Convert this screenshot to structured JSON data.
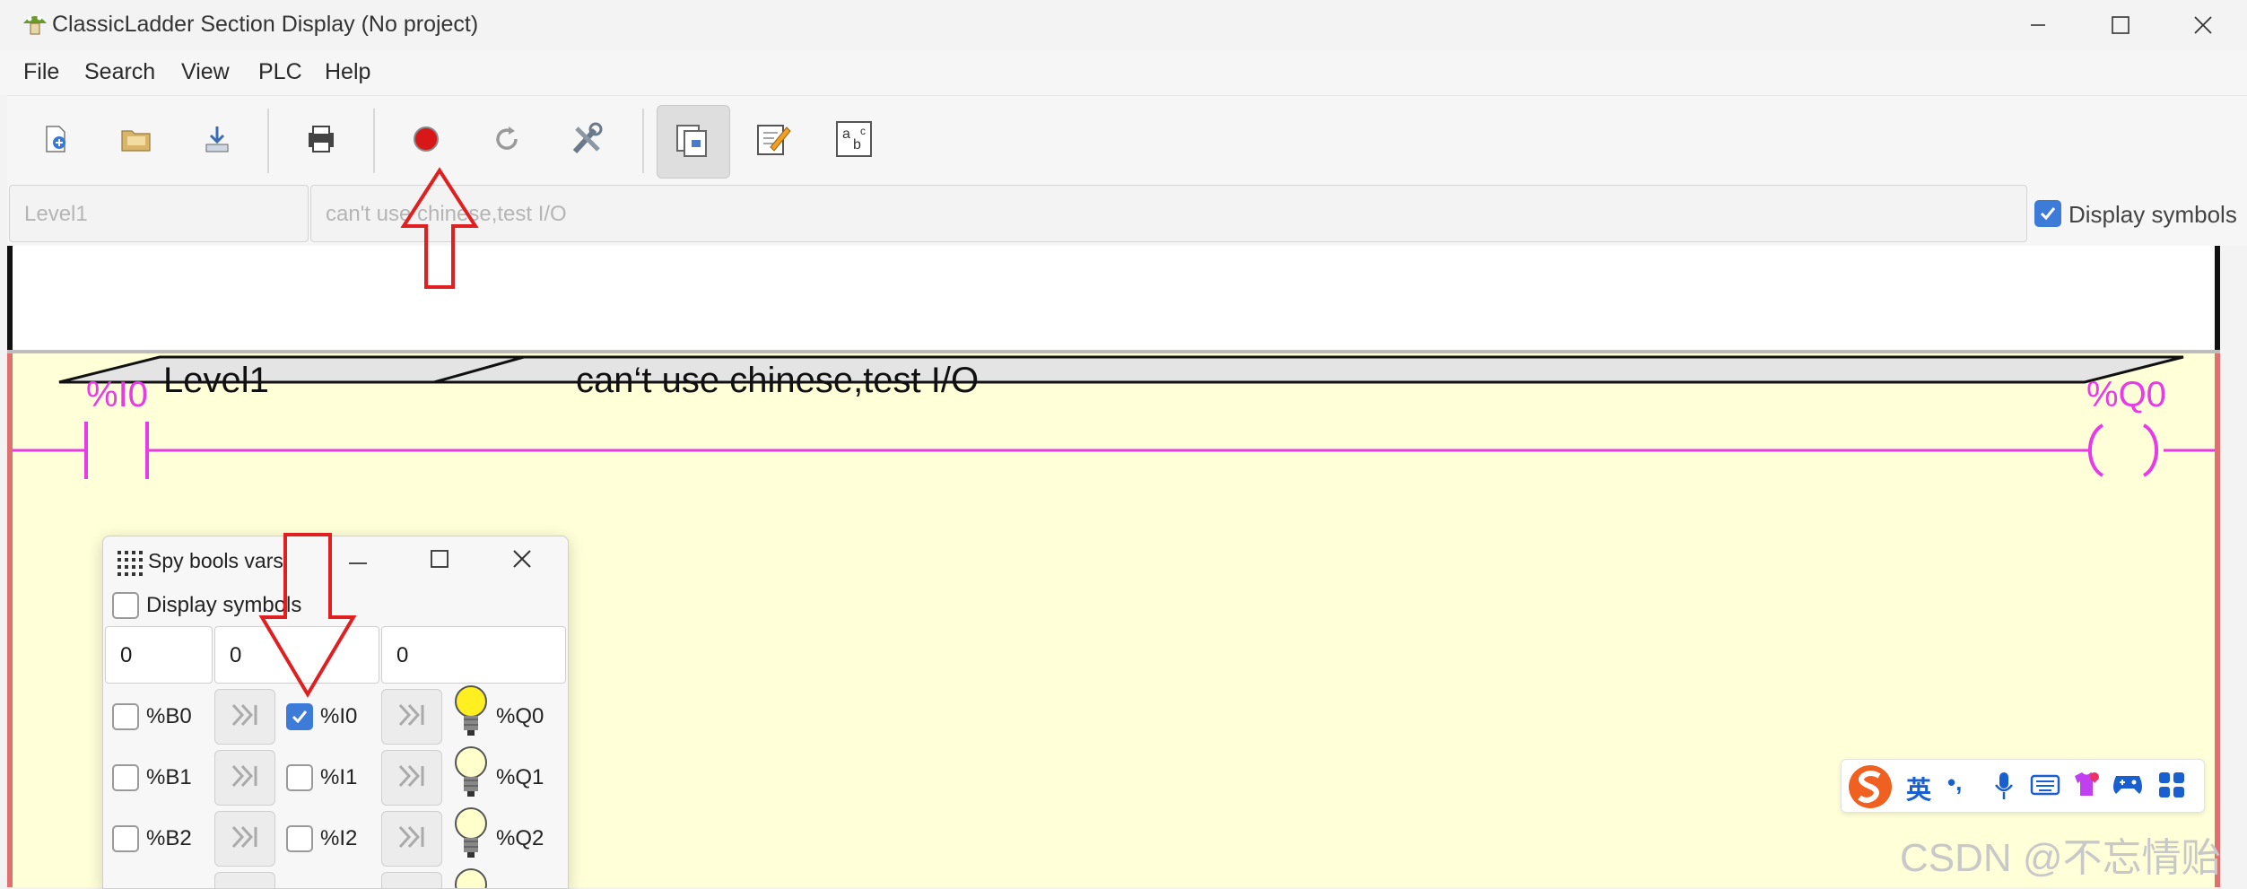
{
  "window": {
    "title": "ClassicLadder Section Display (No project)"
  },
  "menu": [
    "File",
    "Search",
    "View",
    "PLC",
    "Help"
  ],
  "toolbar": {
    "buttons": [
      "new-icon",
      "open-icon",
      "save-icon",
      "print-icon",
      "run-stop-icon",
      "reset-icon",
      "config-icon",
      "sections-icon",
      "editor-icon",
      "symbols-icon"
    ]
  },
  "rung_header": {
    "label_placeholder": "Level1",
    "comment_placeholder": "can't use chinese,test I/O",
    "display_symbols": "Display symbols"
  },
  "rung": {
    "label": "Level1",
    "comment": "can‘t use chinese,test I/O",
    "contact": "%I0",
    "coil": "%Q0"
  },
  "spy": {
    "title": "Spy bools vars",
    "display_symbols": "Display symbols",
    "offsets": [
      "0",
      "0",
      "0"
    ],
    "rows": [
      {
        "b": "%B0",
        "i": "%I0",
        "q": "%Q0",
        "i_checked": true,
        "q_on": true
      },
      {
        "b": "%B1",
        "i": "%I1",
        "q": "%Q1",
        "i_checked": false,
        "q_on": false
      },
      {
        "b": "%B2",
        "i": "%I2",
        "q": "%Q2",
        "i_checked": false,
        "q_on": false
      }
    ]
  },
  "ime": {
    "lang": "英",
    "punct": "•,"
  },
  "watermark": "CSDN @不忘情贻",
  "colors": {
    "ladder": "#e83ae8",
    "rung_bg": "#ffffd8",
    "rail": "#e07070",
    "checkbox": "#3d7bd9",
    "annotation_arrow": "#e02020"
  }
}
